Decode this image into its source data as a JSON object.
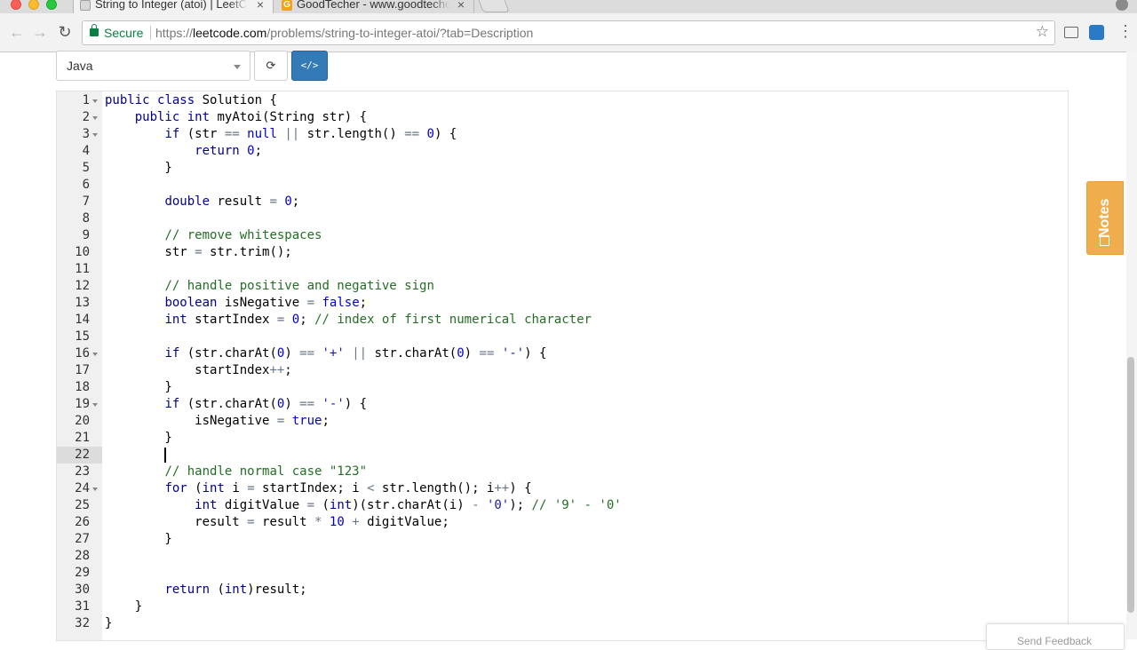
{
  "browser": {
    "tabs": [
      {
        "title": "String to Integer (atoi) | LeetCode",
        "active": true
      },
      {
        "title": "GoodTecher - www.goodtecher.com",
        "active": false
      }
    ],
    "address_bar": {
      "secure_label": "Secure",
      "scheme": "https://",
      "host": "leetcode.com",
      "path": "/problems/string-to-integer-atoi/?tab=Description"
    },
    "colors": {
      "secure": "#0b8043",
      "accent": "#337ab7"
    }
  },
  "editor_toolbar": {
    "language": "Java",
    "reset_icon": "refresh-icon",
    "code_icon": "code-brackets-icon",
    "code_label": "</>"
  },
  "code": {
    "cursor_line": 22,
    "lines": [
      {
        "n": "1",
        "fold": true,
        "html": "<span class=\"kw\">public</span> <span class=\"kw\">class</span> Solution {"
      },
      {
        "n": "2",
        "fold": true,
        "html": "    <span class=\"kw\">public</span> <span class=\"kw\">int</span> myAtoi(String str) {"
      },
      {
        "n": "3",
        "fold": true,
        "html": "        <span class=\"kw\">if</span> (str <span class=\"op\">==</span> <span class=\"lit\">null</span> <span class=\"op\">||</span> str.length() <span class=\"op\">==</span> <span class=\"lit\">0</span>) {"
      },
      {
        "n": "4",
        "fold": false,
        "html": "            <span class=\"kw\">return</span> <span class=\"lit\">0</span>;"
      },
      {
        "n": "5",
        "fold": false,
        "html": "        }"
      },
      {
        "n": "6",
        "fold": false,
        "html": ""
      },
      {
        "n": "7",
        "fold": false,
        "html": "        <span class=\"kw\">double</span> result <span class=\"op\">=</span> <span class=\"lit\">0</span>;"
      },
      {
        "n": "8",
        "fold": false,
        "html": ""
      },
      {
        "n": "9",
        "fold": false,
        "html": "        <span class=\"cm\">// remove whitespaces</span>"
      },
      {
        "n": "10",
        "fold": false,
        "html": "        str <span class=\"op\">=</span> str.trim();"
      },
      {
        "n": "11",
        "fold": false,
        "html": ""
      },
      {
        "n": "12",
        "fold": false,
        "html": "        <span class=\"cm\">// handle positive and negative sign</span>"
      },
      {
        "n": "13",
        "fold": false,
        "html": "        <span class=\"kw\">boolean</span> isNegative <span class=\"op\">=</span> <span class=\"lit\">false</span>;"
      },
      {
        "n": "14",
        "fold": false,
        "html": "        <span class=\"kw\">int</span> startIndex <span class=\"op\">=</span> <span class=\"lit\">0</span>; <span class=\"cm\">// index of first numerical character</span>"
      },
      {
        "n": "15",
        "fold": false,
        "html": ""
      },
      {
        "n": "16",
        "fold": true,
        "html": "        <span class=\"kw\">if</span> (str.charAt(<span class=\"lit\">0</span>) <span class=\"op\">==</span> <span class=\"str\">'+'</span> <span class=\"op\">||</span> str.charAt(<span class=\"lit\">0</span>) <span class=\"op\">==</span> <span class=\"str\">'-'</span>) {"
      },
      {
        "n": "17",
        "fold": false,
        "html": "            startIndex<span class=\"op\">++</span>;"
      },
      {
        "n": "18",
        "fold": false,
        "html": "        }"
      },
      {
        "n": "19",
        "fold": true,
        "html": "        <span class=\"kw\">if</span> (str.charAt(<span class=\"lit\">0</span>) <span class=\"op\">==</span> <span class=\"str\">'-'</span>) {"
      },
      {
        "n": "20",
        "fold": false,
        "html": "            isNegative <span class=\"op\">=</span> <span class=\"lit\">true</span>;"
      },
      {
        "n": "21",
        "fold": false,
        "html": "        }"
      },
      {
        "n": "22",
        "fold": false,
        "html": "        "
      },
      {
        "n": "23",
        "fold": false,
        "html": "        <span class=\"cm\">// handle normal case \"123\"</span>"
      },
      {
        "n": "24",
        "fold": true,
        "html": "        <span class=\"kw\">for</span> (<span class=\"kw\">int</span> i <span class=\"op\">=</span> startIndex; i <span class=\"op\">&lt;</span> str.length(); i<span class=\"op\">++</span>) {"
      },
      {
        "n": "25",
        "fold": false,
        "html": "            <span class=\"kw\">int</span> digitValue <span class=\"op\">=</span> (<span class=\"kw\">int</span>)(str.charAt(i) <span class=\"op\">-</span> <span class=\"str\">'0'</span>); <span class=\"cm\">// '9' - '0'</span>"
      },
      {
        "n": "26",
        "fold": false,
        "html": "            result <span class=\"op\">=</span> result <span class=\"op\">*</span> <span class=\"lit\">10</span> <span class=\"op\">+</span> digitValue;"
      },
      {
        "n": "27",
        "fold": false,
        "html": "        }"
      },
      {
        "n": "28",
        "fold": false,
        "html": ""
      },
      {
        "n": "29",
        "fold": false,
        "html": ""
      },
      {
        "n": "30",
        "fold": false,
        "html": "        <span class=\"kw\">return</span> (<span class=\"kw\">int</span>)result;"
      },
      {
        "n": "31",
        "fold": false,
        "html": "    }"
      },
      {
        "n": "32",
        "fold": false,
        "html": "}"
      }
    ]
  },
  "side": {
    "notes_label": "Notes",
    "notes_icon": "note-icon",
    "feedback_label": "Send Feedback",
    "feedback_icon": "filter-icon"
  }
}
